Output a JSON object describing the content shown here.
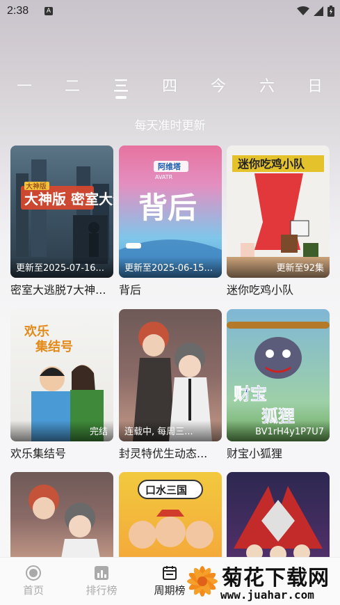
{
  "status": {
    "time": "2:38",
    "notif": "A"
  },
  "weekdays": [
    "一",
    "二",
    "三",
    "四",
    "今",
    "六",
    "日"
  ],
  "active_day_index": 2,
  "subtitle": "每天准时更新",
  "items": [
    {
      "title": "密室大逃脱7大神...",
      "badge": "更新至2025-07-16..."
    },
    {
      "title": "背后",
      "badge": "更新至2025-06-15..."
    },
    {
      "title": "迷你吃鸡小队",
      "badge": "更新至92集"
    },
    {
      "title": "欢乐集结号",
      "badge": "完结"
    },
    {
      "title": "封灵特优生动态...",
      "badge": "连载中, 每周三..."
    },
    {
      "title": "财宝小狐狸",
      "badge": "BV1rH4y1P7U7"
    }
  ],
  "poster_texts": {
    "escape": "大神版 密室大逃脱",
    "behind_top": "阿维塔 AVATR",
    "behind": "背后",
    "chicken": "迷你吃鸡小队",
    "happy": "欢乐集结号",
    "fox": "财宝小狐狸",
    "shui": "口水三国"
  },
  "tabs": [
    {
      "label": "首页",
      "icon": "home-icon"
    },
    {
      "label": "排行榜",
      "icon": "chart-icon"
    },
    {
      "label": "周期榜",
      "icon": "calendar-icon"
    }
  ],
  "watermark": {
    "title": "菊花下载网",
    "url": "www.juahar.com"
  }
}
